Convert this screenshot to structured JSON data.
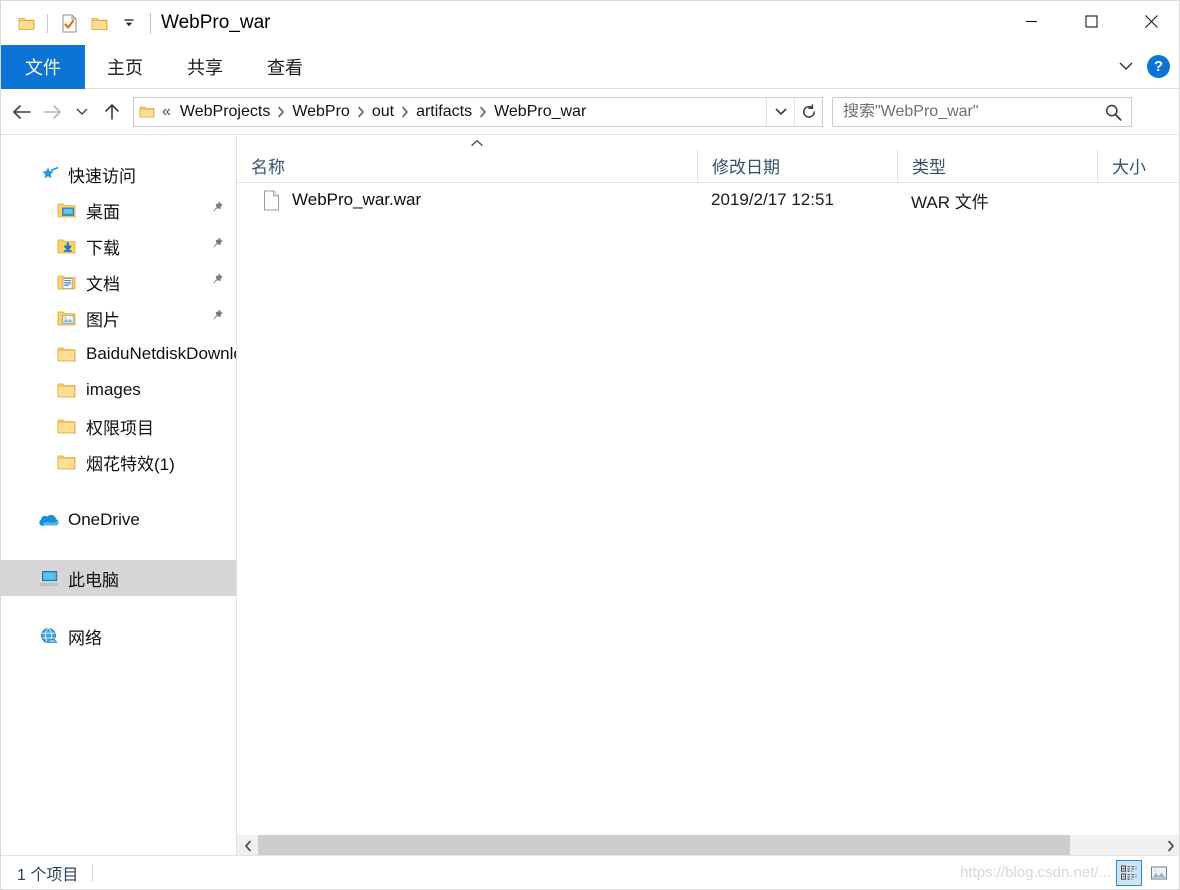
{
  "window": {
    "title": "WebPro_war",
    "quick_access": [
      {
        "icon": "folder-icon",
        "name": "qat-folder-button"
      },
      {
        "icon": "properties-icon",
        "name": "qat-properties-button"
      },
      {
        "icon": "new-folder-icon",
        "name": "qat-new-folder-button"
      },
      {
        "icon": "chevron-down-icon",
        "name": "qat-customize-button"
      }
    ],
    "controls": {
      "minimize": "—",
      "maximize": "□",
      "close": "✕"
    }
  },
  "ribbon": {
    "tabs": [
      {
        "label": "文件",
        "name": "tab-file",
        "active": true
      },
      {
        "label": "主页",
        "name": "tab-home",
        "active": false
      },
      {
        "label": "共享",
        "name": "tab-share",
        "active": false
      },
      {
        "label": "查看",
        "name": "tab-view",
        "active": false
      }
    ],
    "expand_icon": "chevron-down-icon",
    "help_label": "?"
  },
  "navbar": {
    "back_icon": "arrow-left-icon",
    "forward_icon": "arrow-right-icon",
    "recent_icon": "chevron-down-icon",
    "up_icon": "arrow-up-icon",
    "address": {
      "overflow": "«",
      "folder_icon": "folder-icon",
      "crumbs": [
        "WebProjects",
        "WebPro",
        "out",
        "artifacts",
        "WebPro_war"
      ],
      "separator": "❯",
      "dropdown_icon": "chevron-down-icon",
      "refresh_icon": "refresh-icon"
    }
  },
  "search": {
    "placeholder": "搜索\"WebPro_war\"",
    "value": "",
    "icon": "search-icon"
  },
  "sidebar": {
    "items": [
      {
        "label": "快速访问",
        "icon": "star-pin-icon",
        "level": 0,
        "pinned": false,
        "selected": false,
        "name": "sidebar-item-quick-access"
      },
      {
        "label": "桌面",
        "icon": "folder-desktop-icon",
        "level": 1,
        "pinned": true,
        "selected": false,
        "name": "sidebar-item-desktop"
      },
      {
        "label": "下载",
        "icon": "folder-downloads-icon",
        "level": 1,
        "pinned": true,
        "selected": false,
        "name": "sidebar-item-downloads"
      },
      {
        "label": "文档",
        "icon": "folder-documents-icon",
        "level": 1,
        "pinned": true,
        "selected": false,
        "name": "sidebar-item-documents"
      },
      {
        "label": "图片",
        "icon": "folder-pictures-icon",
        "level": 1,
        "pinned": true,
        "selected": false,
        "name": "sidebar-item-pictures"
      },
      {
        "label": "BaiduNetdiskDownload",
        "icon": "folder-icon",
        "level": 1,
        "pinned": false,
        "selected": false,
        "name": "sidebar-item-baidunetdiskdownload"
      },
      {
        "label": "images",
        "icon": "folder-icon",
        "level": 1,
        "pinned": false,
        "selected": false,
        "name": "sidebar-item-images"
      },
      {
        "label": "权限项目",
        "icon": "folder-icon",
        "level": 1,
        "pinned": false,
        "selected": false,
        "name": "sidebar-item-permissions-project"
      },
      {
        "label": "烟花特效(1)",
        "icon": "folder-icon",
        "level": 1,
        "pinned": false,
        "selected": false,
        "name": "sidebar-item-fireworks-effect"
      },
      {
        "label": "OneDrive",
        "icon": "onedrive-cloud-icon",
        "level": 0,
        "pinned": false,
        "selected": false,
        "name": "sidebar-item-onedrive"
      },
      {
        "label": "此电脑",
        "icon": "this-pc-icon",
        "level": 0,
        "pinned": false,
        "selected": true,
        "name": "sidebar-item-this-pc"
      },
      {
        "label": "网络",
        "icon": "network-globe-icon",
        "level": 0,
        "pinned": false,
        "selected": false,
        "name": "sidebar-item-network"
      }
    ]
  },
  "filelist": {
    "sort_indicator": "˄",
    "columns": [
      {
        "label": "名称",
        "name": "column-header-name"
      },
      {
        "label": "修改日期",
        "name": "column-header-date-modified"
      },
      {
        "label": "类型",
        "name": "column-header-type"
      },
      {
        "label": "大小",
        "name": "column-header-size"
      }
    ],
    "rows": [
      {
        "icon": "file-generic-icon",
        "name": "WebPro_war.war",
        "date_modified": "2019/2/17 12:51",
        "type": "WAR 文件",
        "size": ""
      }
    ],
    "hscroll": {
      "left_icon": "chevron-left-icon",
      "right_icon": "chevron-right-icon"
    }
  },
  "statusbar": {
    "item_count": "1 个项目",
    "views": [
      {
        "icon": "details-view-icon",
        "active": true,
        "name": "view-details-button"
      },
      {
        "icon": "large-icons-view-icon",
        "active": false,
        "name": "view-large-icons-button"
      }
    ],
    "watermark": "https://blog.csdn.net/..."
  },
  "colors": {
    "accent": "#0c74d4",
    "folder": "#ffd06b",
    "selected_row": "#d6d6d6",
    "header_text": "#37506e"
  }
}
